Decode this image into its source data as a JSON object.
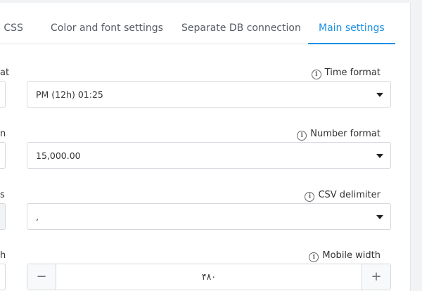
{
  "tabs": [
    {
      "label": "d CSS"
    },
    {
      "label": "Color and font settings"
    },
    {
      "label": "Separate DB connection"
    },
    {
      "label": "Main settings"
    }
  ],
  "active_tab": "Main settings",
  "left_labels": [
    "at",
    "n",
    "s",
    "h"
  ],
  "fields": {
    "time_format": {
      "label": "Time format",
      "value": "PM (12h) 01:25"
    },
    "number_format": {
      "label": "Number format",
      "value": "15,000.00"
    },
    "csv_delimiter": {
      "label": "CSV delimiter",
      "value": ","
    },
    "mobile_width": {
      "label": "Mobile width",
      "value": "۴۸۰",
      "minus": "−",
      "plus": "+"
    }
  },
  "icons": {
    "info": "i"
  },
  "colors": {
    "accent": "#1a8fe3",
    "border": "#d5d9de",
    "background": "#f1f3f5"
  }
}
